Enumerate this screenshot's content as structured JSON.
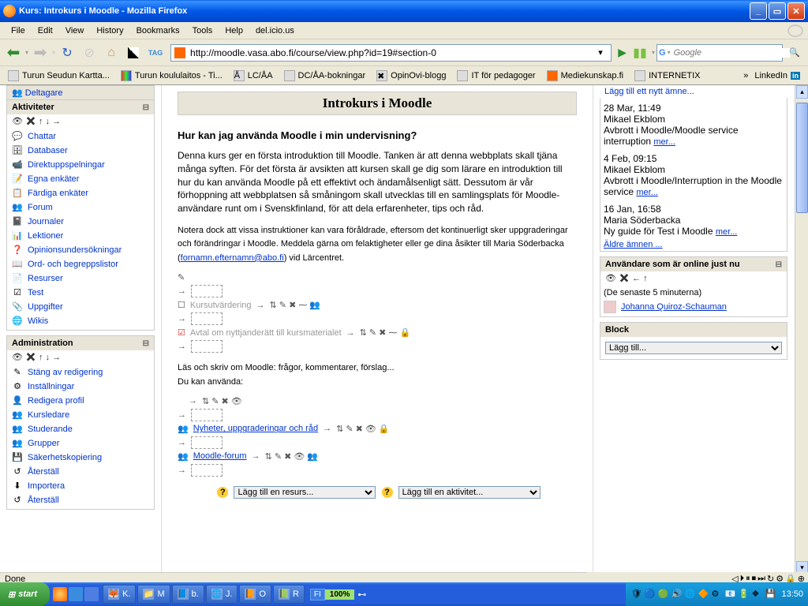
{
  "window": {
    "title": "Kurs: Introkurs i Moodle - Mozilla Firefox"
  },
  "menu": {
    "file": "File",
    "edit": "Edit",
    "view": "View",
    "history": "History",
    "bookmarks": "Bookmarks",
    "tools": "Tools",
    "help": "Help",
    "delicious": "del.icio.us"
  },
  "url": "http://moodle.vasa.abo.fi/course/view.php?id=19#section-0",
  "search_placeholder": "Google",
  "bookmarks": [
    "Turun Seudun Kartta...",
    "Turun koululaitos - Ti...",
    "LC/ÅA",
    "DC/ÅA-bokningar",
    "OpinOvi-blogg",
    "IT för pedagoger",
    "Mediekunskap.fi",
    "INTERNETIX"
  ],
  "linkedin": "LinkedIn",
  "deltagare": "Deltagare",
  "blocks": {
    "aktiviteter": {
      "title": "Aktiviteter",
      "items": [
        "Chattar",
        "Databaser",
        "Direktuppspelningar",
        "Egna enkäter",
        "Färdiga enkäter",
        "Forum",
        "Journaler",
        "Lektioner",
        "Opinionsundersökningar",
        "Ord- och begreppslistor",
        "Resurser",
        "Test",
        "Uppgifter",
        "Wikis"
      ]
    },
    "admin": {
      "title": "Administration",
      "items": [
        "Stäng av redigering",
        "Inställningar",
        "Redigera profil",
        "Kursledare",
        "Studerande",
        "Grupper",
        "Säkerhetskopiering",
        "Återställ",
        "Importera",
        "Återställ"
      ]
    },
    "course": {
      "title": "Introkurs i Moodle",
      "h3": "Hur kan jag använda Moodle i min undervisning?",
      "p1": "Denna kurs ger en första introduktion till Moodle. Tanken är att denna webbplats skall tjäna många syften. För det första är avsikten att kursen skall ge dig som lärare en introduktion till hur du kan använda Moodle på ett effektivt och ändamålsenligt sätt. Dessutom är vår förhoppning att webbplatsen så småningom skall utvecklas till en samlingsplats för Moodle-användare runt om i Svenskfinland, för att dela erfarenheter, tips och råd.",
      "p2a": "Notera dock att vissa instruktioner kan vara föråldrade, eftersom det kontinuerligt sker uppgraderingar och förändringar i Moodle. Meddela gärna om felaktigheter eller ge dina åsikter till Maria Söderbacka (",
      "email": "fornamn.efternamn@abo.fi",
      "p2b": ") vid Lärcentret.",
      "kursutv": "Kursutvärdering",
      "avtal": "Avtal om nyttjanderätt till kursmaterialet",
      "las": "Läs och skriv om Moodle: frågor, kommentarer, förslag...",
      "duk": "Du kan använda:",
      "nyheter": "Nyheter, uppgraderingar och råd",
      "mforum": "Moodle-forum",
      "resurs": "Lägg till en resurs...",
      "aktivitet": "Lägg till en aktivitet..."
    },
    "forum_top": "Lägg till ett nytt ämne...",
    "news": [
      {
        "date": "28 Mar, 11:49",
        "author": "Mikael Ekblom",
        "subj": "Avbrott i Moodle/Moodle service interruption"
      },
      {
        "date": "4 Feb, 09:15",
        "author": "Mikael Ekblom",
        "subj": "Avbrott i Moodle/Interruption in the Moodle service"
      },
      {
        "date": "16 Jan, 16:58",
        "author": "Maria Söderbacka",
        "subj": "Ny guide för Test i Moodle"
      }
    ],
    "mer": "mer...",
    "aldre": "Äldre ämnen ...",
    "online": {
      "title": "Användare som är online just nu",
      "sub": "(De senaste 5 minuterna)",
      "user": "Johanna Quiroz-Schauman"
    },
    "blockadd": {
      "title": "Block",
      "opt": "Lägg till..."
    }
  },
  "status": "Done",
  "taskbar": {
    "start": "start",
    "buttons": [
      "K.",
      "M",
      "b.",
      "J.",
      "O",
      "R"
    ],
    "lang": "FI",
    "zoom": "100%",
    "clock": "13:50"
  }
}
